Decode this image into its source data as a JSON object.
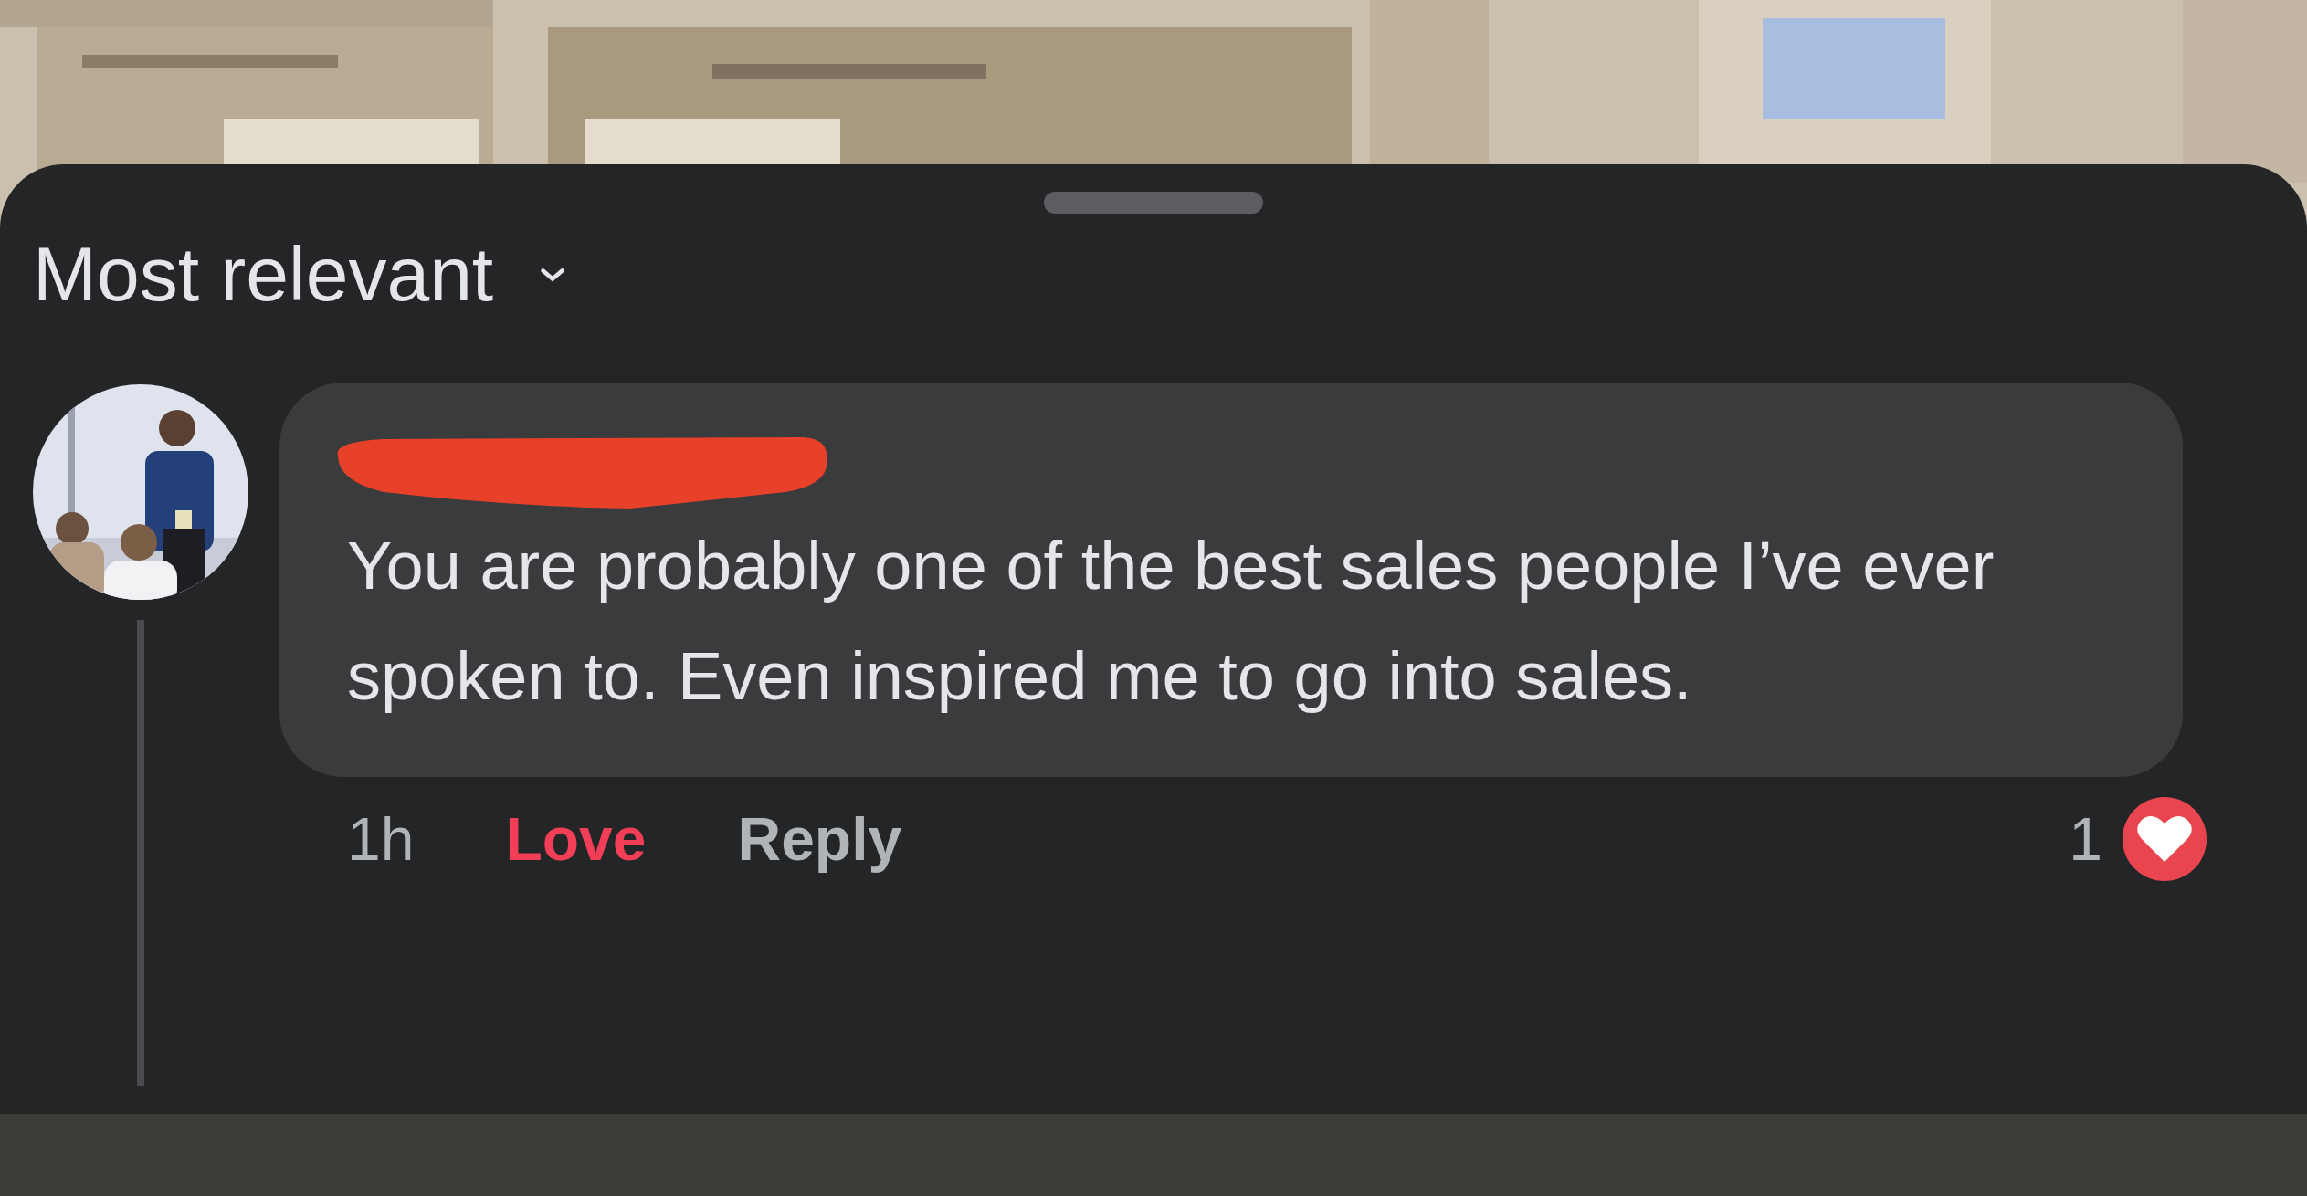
{
  "sort": {
    "label": "Most relevant"
  },
  "comment": {
    "author_redacted": true,
    "text": "You are probably one of the best sales people I’ve ever spoken to. Even inspired me to go into sales.",
    "time": "1h",
    "reacted": true,
    "love_label": "Love",
    "reply_label": "Reply",
    "reaction_count": "1"
  }
}
